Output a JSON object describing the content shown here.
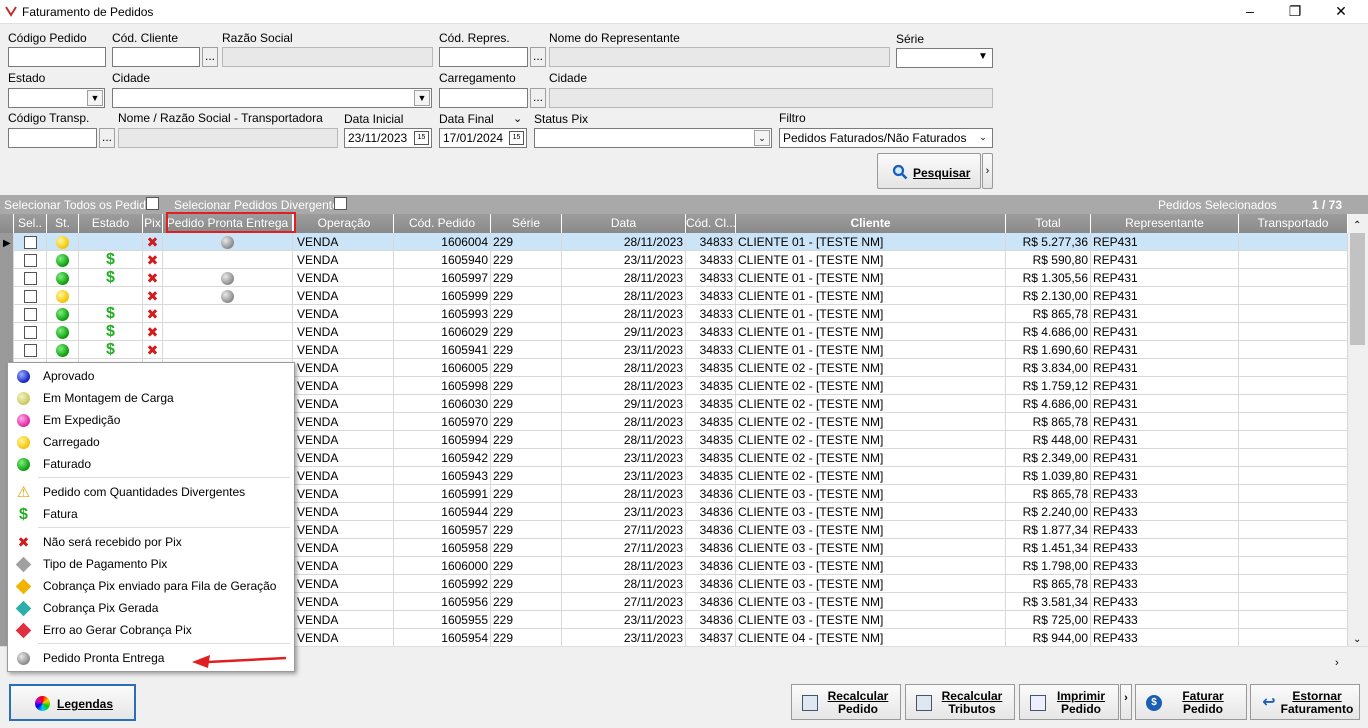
{
  "window": {
    "title": "Faturamento de Pedidos"
  },
  "filters": {
    "codigo_pedido": "Código Pedido",
    "cod_cliente": "Cód. Cliente",
    "razao_social": "Razão Social",
    "cod_repres": "Cód. Repres.",
    "nome_representante": "Nome do Representante",
    "serie": "Série",
    "estado": "Estado",
    "cidade": "Cidade",
    "carregamento": "Carregamento",
    "cidade2": "Cidade",
    "codigo_transp": "Código Transp.",
    "nome_transp": "Nome / Razão Social - Transportadora",
    "data_inicial": "Data Inicial",
    "data_inicial_value": "23/11/2023",
    "data_final": "Data Final",
    "data_final_value": "17/01/2024",
    "status_pix": "Status Pix",
    "filtro": "Filtro",
    "filtro_value": "Pedidos Faturados/Não Faturados",
    "dots": "...",
    "cal_icon": "15"
  },
  "search": {
    "label": "Pesquisar"
  },
  "gridbar": {
    "select_all": "Selecionar Todos os Pedidos",
    "select_divergent": "Selecionar Pedidos Divergentes",
    "selected_label": "Pedidos Selecionados",
    "selected_count": "1 / 73"
  },
  "columns": [
    "Sel..",
    "St.",
    "Estado",
    "Pix",
    "Pedido Pronta Entrega",
    "Operação",
    "Cód. Pedido",
    "Série",
    "Data",
    "Cód. Cl...",
    "Cliente",
    "Total",
    "Representante",
    "Transportado"
  ],
  "rows": [
    {
      "st": "y",
      "estado": "",
      "pix": "x",
      "pronta": true,
      "op": "VENDA",
      "cod": "1606004",
      "serie": "229",
      "data": "28/11/2023",
      "cli": "34833",
      "cliente": "CLIENTE 01 - [TESTE NM]",
      "total": "R$ 5.277,36",
      "rep": "REP431"
    },
    {
      "st": "g",
      "estado": "$",
      "pix": "x",
      "pronta": false,
      "op": "VENDA",
      "cod": "1605940",
      "serie": "229",
      "data": "23/11/2023",
      "cli": "34833",
      "cliente": "CLIENTE 01 - [TESTE NM]",
      "total": "R$ 590,80",
      "rep": "REP431"
    },
    {
      "st": "g",
      "estado": "$",
      "pix": "x",
      "pronta": true,
      "op": "VENDA",
      "cod": "1605997",
      "serie": "229",
      "data": "28/11/2023",
      "cli": "34833",
      "cliente": "CLIENTE 01 - [TESTE NM]",
      "total": "R$ 1.305,56",
      "rep": "REP431"
    },
    {
      "st": "y",
      "estado": "",
      "pix": "x",
      "pronta": true,
      "op": "VENDA",
      "cod": "1605999",
      "serie": "229",
      "data": "28/11/2023",
      "cli": "34833",
      "cliente": "CLIENTE 01 - [TESTE NM]",
      "total": "R$ 2.130,00",
      "rep": "REP431"
    },
    {
      "st": "g",
      "estado": "$",
      "pix": "x",
      "pronta": false,
      "op": "VENDA",
      "cod": "1605993",
      "serie": "229",
      "data": "28/11/2023",
      "cli": "34833",
      "cliente": "CLIENTE 01 - [TESTE NM]",
      "total": "R$ 865,78",
      "rep": "REP431"
    },
    {
      "st": "g",
      "estado": "$",
      "pix": "x",
      "pronta": false,
      "op": "VENDA",
      "cod": "1606029",
      "serie": "229",
      "data": "29/11/2023",
      "cli": "34833",
      "cliente": "CLIENTE 01 - [TESTE NM]",
      "total": "R$ 4.686,00",
      "rep": "REP431"
    },
    {
      "st": "g",
      "estado": "$",
      "pix": "x",
      "pronta": false,
      "op": "VENDA",
      "cod": "1605941",
      "serie": "229",
      "data": "23/11/2023",
      "cli": "34833",
      "cliente": "CLIENTE 01 - [TESTE NM]",
      "total": "R$ 1.690,60",
      "rep": "REP431"
    },
    {
      "op": "VENDA",
      "cod": "1606005",
      "serie": "229",
      "data": "28/11/2023",
      "cli": "34835",
      "cliente": "CLIENTE 02 - [TESTE NM]",
      "total": "R$ 3.834,00",
      "rep": "REP431"
    },
    {
      "op": "VENDA",
      "cod": "1605998",
      "serie": "229",
      "data": "28/11/2023",
      "cli": "34835",
      "cliente": "CLIENTE 02 - [TESTE NM]",
      "total": "R$ 1.759,12",
      "rep": "REP431"
    },
    {
      "op": "VENDA",
      "cod": "1606030",
      "serie": "229",
      "data": "29/11/2023",
      "cli": "34835",
      "cliente": "CLIENTE 02 - [TESTE NM]",
      "total": "R$ 4.686,00",
      "rep": "REP431"
    },
    {
      "op": "VENDA",
      "cod": "1605970",
      "serie": "229",
      "data": "28/11/2023",
      "cli": "34835",
      "cliente": "CLIENTE 02 - [TESTE NM]",
      "total": "R$ 865,78",
      "rep": "REP431"
    },
    {
      "op": "VENDA",
      "cod": "1605994",
      "serie": "229",
      "data": "28/11/2023",
      "cli": "34835",
      "cliente": "CLIENTE 02 - [TESTE NM]",
      "total": "R$ 448,00",
      "rep": "REP431"
    },
    {
      "op": "VENDA",
      "cod": "1605942",
      "serie": "229",
      "data": "23/11/2023",
      "cli": "34835",
      "cliente": "CLIENTE 02 - [TESTE NM]",
      "total": "R$ 2.349,00",
      "rep": "REP431"
    },
    {
      "op": "VENDA",
      "cod": "1605943",
      "serie": "229",
      "data": "23/11/2023",
      "cli": "34835",
      "cliente": "CLIENTE 02 - [TESTE NM]",
      "total": "R$ 1.039,80",
      "rep": "REP431"
    },
    {
      "op": "VENDA",
      "cod": "1605991",
      "serie": "229",
      "data": "28/11/2023",
      "cli": "34836",
      "cliente": "CLIENTE 03 - [TESTE NM]",
      "total": "R$ 865,78",
      "rep": "REP433"
    },
    {
      "op": "VENDA",
      "cod": "1605944",
      "serie": "229",
      "data": "23/11/2023",
      "cli": "34836",
      "cliente": "CLIENTE 03 - [TESTE NM]",
      "total": "R$ 2.240,00",
      "rep": "REP433"
    },
    {
      "op": "VENDA",
      "cod": "1605957",
      "serie": "229",
      "data": "27/11/2023",
      "cli": "34836",
      "cliente": "CLIENTE 03 - [TESTE NM]",
      "total": "R$ 1.877,34",
      "rep": "REP433"
    },
    {
      "op": "VENDA",
      "cod": "1605958",
      "serie": "229",
      "data": "27/11/2023",
      "cli": "34836",
      "cliente": "CLIENTE 03 - [TESTE NM]",
      "total": "R$ 1.451,34",
      "rep": "REP433"
    },
    {
      "op": "VENDA",
      "cod": "1606000",
      "serie": "229",
      "data": "28/11/2023",
      "cli": "34836",
      "cliente": "CLIENTE 03 - [TESTE NM]",
      "total": "R$ 1.798,00",
      "rep": "REP433"
    },
    {
      "op": "VENDA",
      "cod": "1605992",
      "serie": "229",
      "data": "28/11/2023",
      "cli": "34836",
      "cliente": "CLIENTE 03 - [TESTE NM]",
      "total": "R$ 865,78",
      "rep": "REP433"
    },
    {
      "op": "VENDA",
      "cod": "1605956",
      "serie": "229",
      "data": "27/11/2023",
      "cli": "34836",
      "cliente": "CLIENTE 03 - [TESTE NM]",
      "total": "R$ 3.581,34",
      "rep": "REP433"
    },
    {
      "op": "VENDA",
      "cod": "1605955",
      "serie": "229",
      "data": "23/11/2023",
      "cli": "34836",
      "cliente": "CLIENTE 03 - [TESTE NM]",
      "total": "R$ 725,00",
      "rep": "REP433"
    },
    {
      "op": "VENDA",
      "cod": "1605954",
      "serie": "229",
      "data": "23/11/2023",
      "cli": "34837",
      "cliente": "CLIENTE 04 - [TESTE NM]",
      "total": "R$ 944,00",
      "rep": "REP433"
    }
  ],
  "legend_menu": {
    "items": [
      {
        "icon": "bl",
        "label": "Aprovado"
      },
      {
        "icon": "mc",
        "label": "Em Montagem de Carga"
      },
      {
        "icon": "pk",
        "label": "Em Expedição"
      },
      {
        "icon": "y",
        "label": "Carregado"
      },
      {
        "icon": "g",
        "label": "Faturado"
      },
      {
        "icon": "warn",
        "label": "Pedido com Quantidades Divergentes"
      },
      {
        "icon": "dollar",
        "label": "Fatura"
      },
      {
        "icon": "x",
        "label": "Não será recebido por Pix"
      },
      {
        "icon": "pixgray",
        "label": "Tipo de Pagamento Pix"
      },
      {
        "icon": "pixyellow",
        "label": "Cobrança Pix enviado para Fila de Geração"
      },
      {
        "icon": "pixteal",
        "label": "Cobrança Pix Gerada"
      },
      {
        "icon": "pixred",
        "label": "Erro ao Gerar Cobrança Pix"
      },
      {
        "icon": "gr",
        "label": "Pedido Pronta Entrega"
      }
    ]
  },
  "colors": {
    "highlight_border": "#e02020",
    "arrow": "#e02020",
    "selected_row": "#cce4f7"
  },
  "buttons": {
    "legendas": "Legendas",
    "recalc_pedido": [
      "Recalcular",
      "Pedido"
    ],
    "recalc_tributos": [
      "Recalcular",
      "Tributos"
    ],
    "imprimir": [
      "Imprimir",
      "Pedido"
    ],
    "faturar": [
      "Faturar",
      "Pedido"
    ],
    "estornar": [
      "Estornar",
      "Faturamento"
    ]
  }
}
